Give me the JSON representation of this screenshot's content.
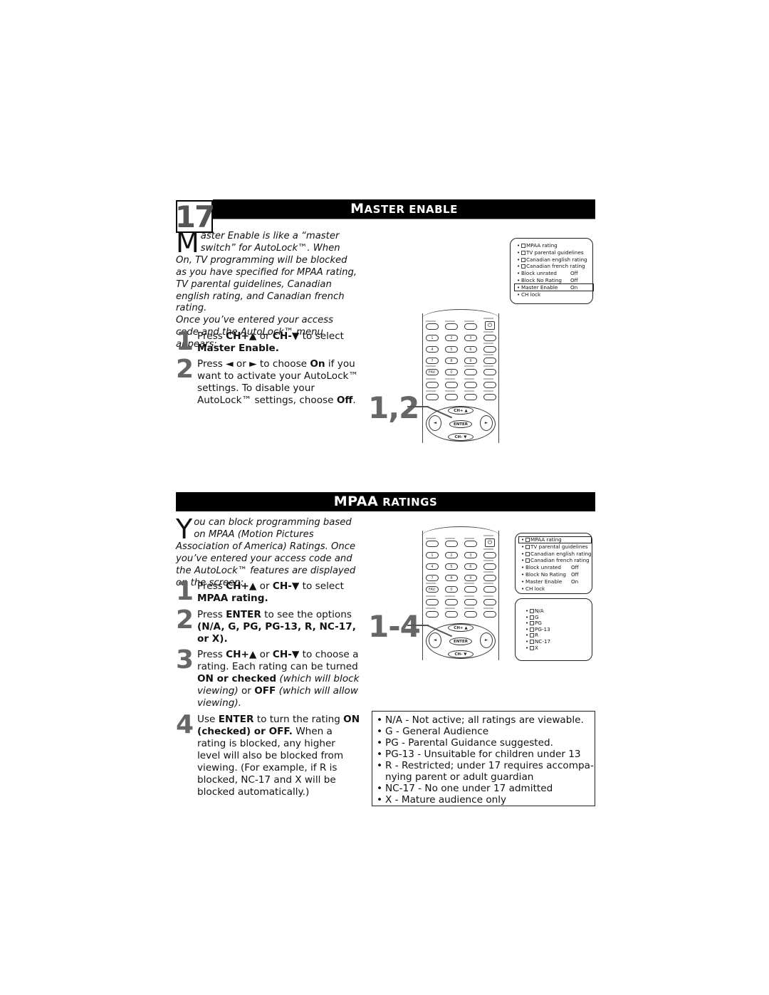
{
  "master_enable_section": {
    "step_number": "17",
    "title_big": "M",
    "title_rest": "ASTER ENABLE",
    "intro_dropcap": "M",
    "intro_text": "aster Enable is like a “master switch” for AutoLock™. When On, TV programming will be blocked as you have specified for MPAA rating, TV parental guidelines, Canadian english rating, and Canadian french rating.",
    "intro_text_2": "Once you’ve entered your access code and the AutoLock™ menu appears:",
    "steps": [
      {
        "num": "1",
        "pre": "Press ",
        "b1": "CH+▲",
        "mid": " or ",
        "b2": "CH-▼",
        "post": " to select ",
        "b3": "Master Enable."
      },
      {
        "num": "2",
        "pre": "Press ◄ or ► to choose ",
        "b1": "On",
        "post": " if you want to activate your AutoLock™ settings. To disable your AutoLock™ settings, choose ",
        "b2": "Off",
        "end": "."
      }
    ],
    "callout": "1,2",
    "osd_menu": [
      {
        "label": "MPAA rating",
        "checkbox": true,
        "value": ""
      },
      {
        "label": "TV parental guidelines",
        "checkbox": true,
        "value": ""
      },
      {
        "label": "Canadian english rating",
        "checkbox": true,
        "value": ""
      },
      {
        "label": "Canadian french rating",
        "checkbox": true,
        "value": ""
      },
      {
        "label": "Block unrated",
        "checkbox": false,
        "value": "Off"
      },
      {
        "label": "Block No Rating",
        "checkbox": false,
        "value": "Off"
      },
      {
        "label": "Master Enable",
        "checkbox": false,
        "value": "On",
        "highlighted": true
      },
      {
        "label": "CH lock",
        "checkbox": false,
        "value": ""
      }
    ]
  },
  "mpaa_section": {
    "title_big": "MPAA",
    "title_rest": "RATINGS",
    "intro_dropcap": "Y",
    "intro_text": "ou can block programming based on MPAA (Motion Pictures Association of America) Ratings. Once you’ve entered your access code and the AutoLock™ features are displayed on the screen:",
    "steps": [
      {
        "num": "1",
        "pre": "Press ",
        "b1": "CH+▲",
        "mid": " or ",
        "b2": "CH-▼",
        "post": " to select ",
        "b3": "MPAA rating."
      },
      {
        "num": "2",
        "pre": "Press ",
        "b1": "ENTER",
        "post": " to see the options ",
        "b2": "(N/A, G, PG, PG-13, R, NC-17, or X)."
      },
      {
        "num": "3",
        "pre": "Press ",
        "b1": "CH+▲",
        "mid": " or ",
        "b2": "CH-▼",
        "post": " to choose a rating. Each rating can be turned ",
        "b3": "ON or checked",
        "i1": " (which will block viewing)",
        "mid2": " or ",
        "b4": "OFF",
        "i2": " (which will allow viewing)."
      },
      {
        "num": "4",
        "pre": "Use ",
        "b1": "ENTER",
        "post": " to turn the rating ",
        "b2": "ON (checked) or OFF.",
        "rest": " When a rating is blocked, any higher level will also be blocked from viewing. (For example, if R is blocked, NC-17 and X will be blocked automatically.)"
      }
    ],
    "callout": "1-4",
    "osd_menu": [
      {
        "label": "MPAA rating",
        "checkbox": true,
        "value": "",
        "highlighted": true
      },
      {
        "label": "TV parental guidelines",
        "checkbox": true,
        "value": ""
      },
      {
        "label": "Canadian english rating",
        "checkbox": true,
        "value": ""
      },
      {
        "label": "Canadian french rating",
        "checkbox": true,
        "value": ""
      },
      {
        "label": "Block unrated",
        "checkbox": false,
        "value": "Off"
      },
      {
        "label": "Block No Rating",
        "checkbox": false,
        "value": "Off"
      },
      {
        "label": "Master Enable",
        "checkbox": false,
        "value": "On"
      },
      {
        "label": "CH lock",
        "checkbox": false,
        "value": ""
      }
    ],
    "osd_ratings": [
      "N/A",
      "G",
      "PG",
      "PG-13",
      "R",
      "NC-17",
      "X"
    ],
    "legend": [
      "N/A - Not active; all ratings are viewable.",
      "G - General Audience",
      "PG - Parental Guidance suggested.",
      "PG-13 - Unsuitable for children under 13",
      "R - Restricted; under 17 requires accompa-",
      "nying parent or adult guardian",
      "NC-17 - No one under 17 admitted",
      "X - Mature audience only"
    ],
    "legend_bullets": [
      true,
      true,
      true,
      true,
      true,
      false,
      true,
      true
    ]
  },
  "remote": {
    "digits": [
      "1",
      "2",
      "3",
      "4",
      "5",
      "6",
      "7",
      "8",
      "9",
      "FAV.",
      "0"
    ],
    "ch_up": "CH+ ▲",
    "ch_down": "CH- ▼",
    "enter": "ENTER",
    "left": "◄",
    "right": "►",
    "power": "⏻"
  }
}
